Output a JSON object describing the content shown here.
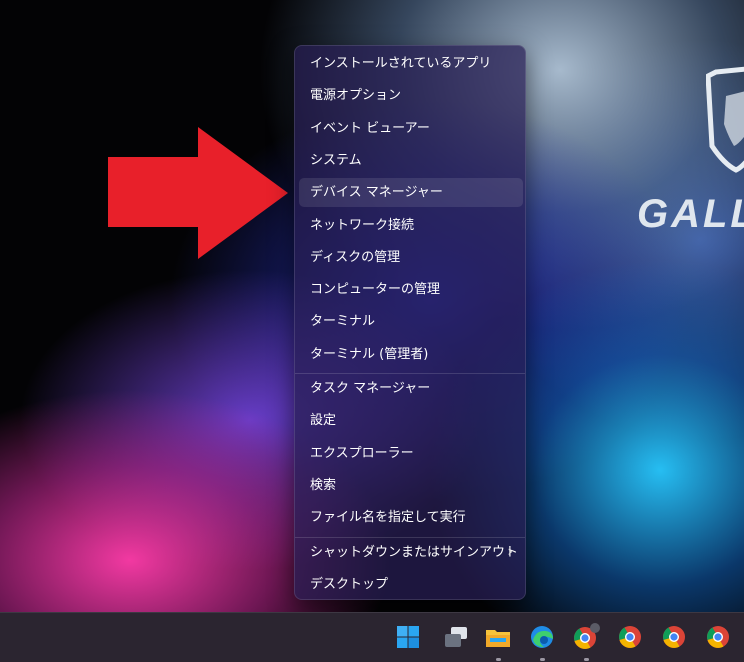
{
  "desktop": {
    "wallpaper_logo_text": "GALL"
  },
  "context_menu": {
    "groups": [
      [
        {
          "label": "インストールされているアプリ"
        },
        {
          "label": "電源オプション"
        },
        {
          "label": "イベント ビューアー"
        },
        {
          "label": "システム"
        },
        {
          "label": "デバイス マネージャー",
          "highlighted": true
        },
        {
          "label": "ネットワーク接続"
        },
        {
          "label": "ディスクの管理"
        },
        {
          "label": "コンピューターの管理"
        },
        {
          "label": "ターミナル"
        },
        {
          "label": "ターミナル (管理者)"
        }
      ],
      [
        {
          "label": "タスク マネージャー"
        },
        {
          "label": "設定"
        },
        {
          "label": "エクスプローラー"
        },
        {
          "label": "検索"
        },
        {
          "label": "ファイル名を指定して実行"
        }
      ],
      [
        {
          "label": "シャットダウンまたはサインアウト",
          "submenu_icon": "chevron-right-icon"
        },
        {
          "label": "デスクトップ"
        }
      ]
    ],
    "submenu_chevron": "›"
  },
  "annotation": {
    "arrow_color": "#e8202a"
  },
  "taskbar": {
    "icons": [
      {
        "name": "windows-start-icon",
        "running": false
      },
      {
        "name": "task-view-icon",
        "running": false
      },
      {
        "name": "file-explorer-icon",
        "running": true
      },
      {
        "name": "edge-browser-icon",
        "running": true
      },
      {
        "name": "chrome-profile-icon",
        "running": true
      },
      {
        "name": "chrome-icon",
        "running": false
      },
      {
        "name": "chrome-icon",
        "running": false
      },
      {
        "name": "chrome-icon",
        "running": false
      }
    ]
  },
  "colors": {
    "menu_background": "#281e55",
    "taskbar_background": "#2b2530",
    "accent_blue": "#2aa6f1"
  }
}
